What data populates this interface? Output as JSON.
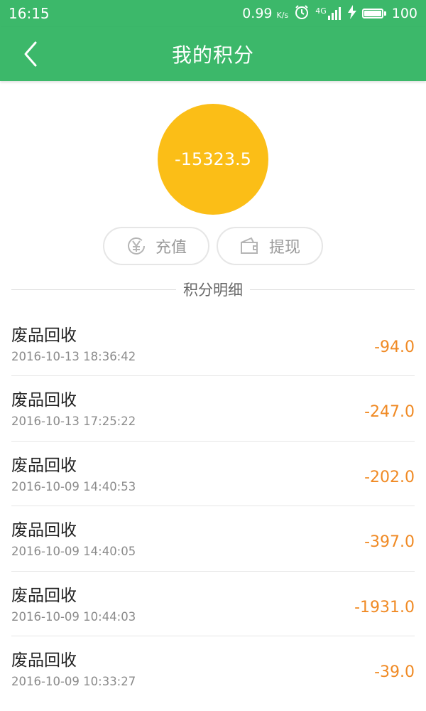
{
  "status_bar": {
    "time": "16:15",
    "speed": "0.99",
    "speed_unit": "K/s",
    "network": "4G",
    "battery": "100"
  },
  "header": {
    "title": "我的积分",
    "back_icon": "chevron-left-icon"
  },
  "score": {
    "value": "-15323.5",
    "color": "#fbbe17"
  },
  "actions": {
    "recharge": {
      "label": "充值",
      "icon": "yen-circle-icon"
    },
    "withdraw": {
      "label": "提现",
      "icon": "wallet-icon"
    }
  },
  "section": {
    "title": "积分明细"
  },
  "records": [
    {
      "name": "废品回收",
      "time": "2016-10-13 18:36:42",
      "amount": "-94.0"
    },
    {
      "name": "废品回收",
      "time": "2016-10-13 17:25:22",
      "amount": "-247.0"
    },
    {
      "name": "废品回收",
      "time": "2016-10-09 14:40:53",
      "amount": "-202.0"
    },
    {
      "name": "废品回收",
      "time": "2016-10-09 14:40:05",
      "amount": "-397.0"
    },
    {
      "name": "废品回收",
      "time": "2016-10-09 10:44:03",
      "amount": "-1931.0"
    },
    {
      "name": "废品回收",
      "time": "2016-10-09 10:33:27",
      "amount": "-39.0"
    }
  ],
  "colors": {
    "brand": "#3cb86a",
    "amount": "#f08a24"
  }
}
